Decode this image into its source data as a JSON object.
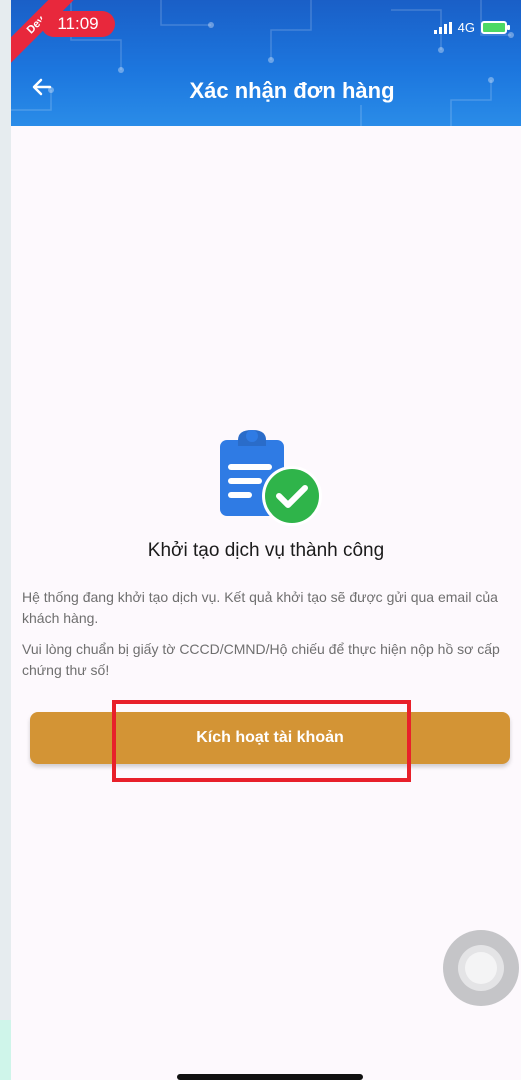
{
  "status_bar": {
    "time": "11:09",
    "ribbon": "Dev",
    "network": "4G"
  },
  "header": {
    "title": "Xác nhận đơn hàng",
    "back_icon": "arrow-left-icon"
  },
  "content": {
    "illustration_icon": "clipboard-check-icon",
    "success_title": "Khởi tạo dịch vụ thành công",
    "description_1": "Hệ thống đang khởi tạo dịch vụ. Kết quả khởi tạo sẽ được gửi qua email của khách hàng.",
    "description_2": "Vui lòng chuẩn bị giấy tờ CCCD/CMND/Hộ chiếu để thực hiện nộp hồ sơ cấp chứng thư số!",
    "activate_button": "Kích hoạt tài khoản"
  },
  "colors": {
    "header": "#1c76de",
    "button": "#d39435",
    "success": "#2fb44a",
    "highlight": "#e8202a"
  }
}
